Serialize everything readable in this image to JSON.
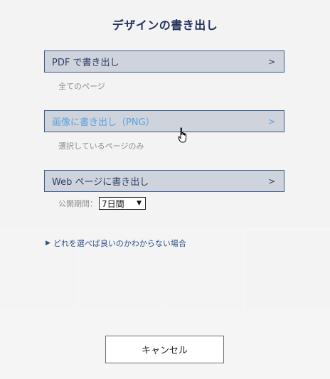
{
  "dialog": {
    "title": "デザインの書き出し",
    "options": [
      {
        "label": "PDF で書き出し",
        "arrow": ">",
        "sub": "全てのページ"
      },
      {
        "label": "画像に書き出し（PNG）",
        "arrow": ">",
        "sub": "選択しているページのみ"
      },
      {
        "label": "Web ページに書き出し",
        "arrow": ">"
      }
    ],
    "period": {
      "label": "公開期間：",
      "value": "7日間"
    },
    "help_link": "どれを選べば良いのかわからない場合",
    "cancel_label": "キャンセル"
  },
  "colors": {
    "title": "#24335c",
    "option_bg": "#cfd3db",
    "option_border": "#3a5a8c",
    "option_text": "#2d3f69",
    "option_hover_text": "#5aa2e0",
    "link": "#2d4f8c"
  },
  "icons": {
    "help_toggle": "triangle-right-icon",
    "select_toggle": "triangle-down-icon",
    "pointer": "hand-pointer-icon"
  }
}
